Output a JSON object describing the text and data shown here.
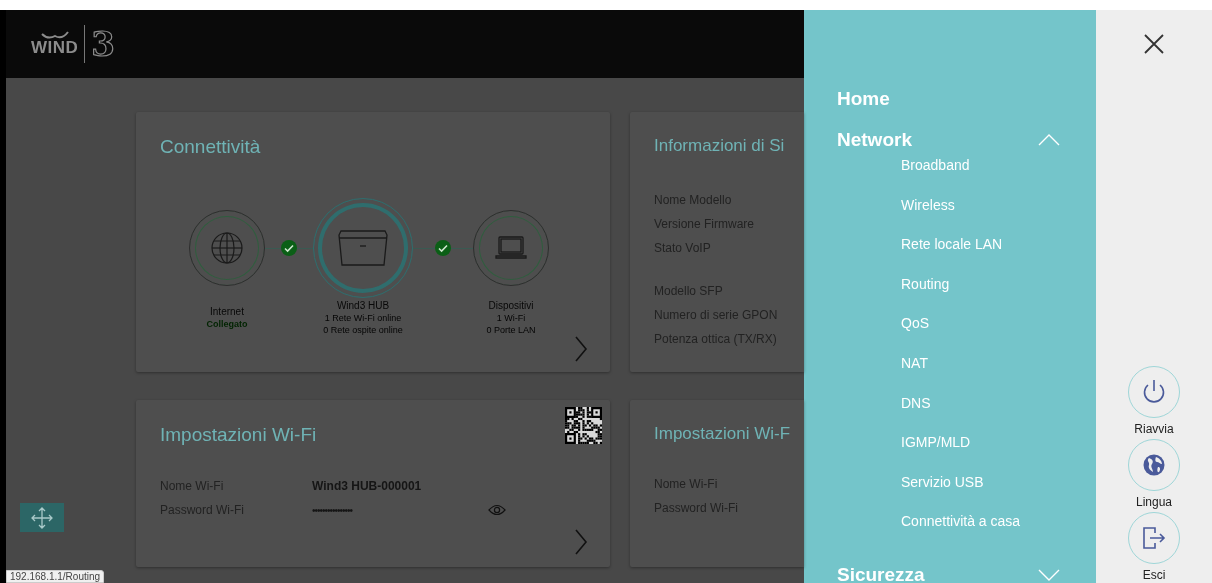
{
  "logo": {
    "word": "WIND",
    "numeral": "3"
  },
  "connectivity_card": {
    "title": "Connettività",
    "nodes": [
      {
        "kind": "globe",
        "active": false,
        "label": "Internet",
        "details": [
          {
            "text": "Collegato",
            "kind": "status"
          }
        ]
      },
      {
        "kind": "router",
        "active": true,
        "label": "Wind3 HUB",
        "details": [
          {
            "text": "1 Rete Wi-Fi online",
            "kind": "plain"
          },
          {
            "text": "0 Rete ospite online",
            "kind": "plain"
          }
        ]
      },
      {
        "kind": "laptop",
        "active": false,
        "label": "Dispositivi",
        "details": [
          {
            "text": "1 Wi-Fi",
            "kind": "plain"
          },
          {
            "text": "0 Porte LAN",
            "kind": "plain"
          }
        ]
      }
    ],
    "links": [
      {
        "ok": true
      },
      {
        "ok": true
      }
    ]
  },
  "system_info_card": {
    "title": "Informazioni di Si",
    "groups": [
      {
        "labels": [
          "Nome Modello",
          "Versione Firmware",
          "Stato VoIP"
        ]
      },
      {
        "labels": [
          "Modello SFP",
          "Numero di serie GPON",
          "Potenza ottica (TX/RX)"
        ]
      }
    ]
  },
  "wifi_card": {
    "title": "Impostazioni Wi-Fi",
    "qr_code": true,
    "fields": [
      {
        "label": "Nome Wi-Fi",
        "value": "Wind3 HUB-000001",
        "kind": "text"
      },
      {
        "label": "Password Wi-Fi",
        "value": "••••••••••••••••",
        "kind": "password"
      }
    ]
  },
  "wifi_card_2": {
    "title": "Impostazioni Wi-F",
    "fields": [
      {
        "label": "Nome Wi-Fi"
      },
      {
        "label": "Password Wi-Fi"
      }
    ]
  },
  "menu": [
    {
      "label": "Home",
      "kind": "link"
    },
    {
      "label": "Network",
      "kind": "group",
      "expanded": true,
      "children": [
        {
          "label": "Broadband"
        },
        {
          "label": "Wireless"
        },
        {
          "label": "Rete locale LAN"
        },
        {
          "label": "Routing"
        },
        {
          "label": "QoS"
        },
        {
          "label": "NAT"
        },
        {
          "label": "DNS"
        },
        {
          "label": "IGMP/MLD"
        },
        {
          "label": "Servizio USB"
        },
        {
          "label": "Connettività a casa"
        }
      ]
    },
    {
      "label": "Sicurezza",
      "kind": "group",
      "expanded": false
    }
  ],
  "actions": [
    {
      "label": "Riavvia",
      "kind": "power"
    },
    {
      "label": "Lingua",
      "kind": "globe"
    },
    {
      "label": "Esci",
      "kind": "logout"
    }
  ],
  "status_url": "192.168.1.1/Routing"
}
